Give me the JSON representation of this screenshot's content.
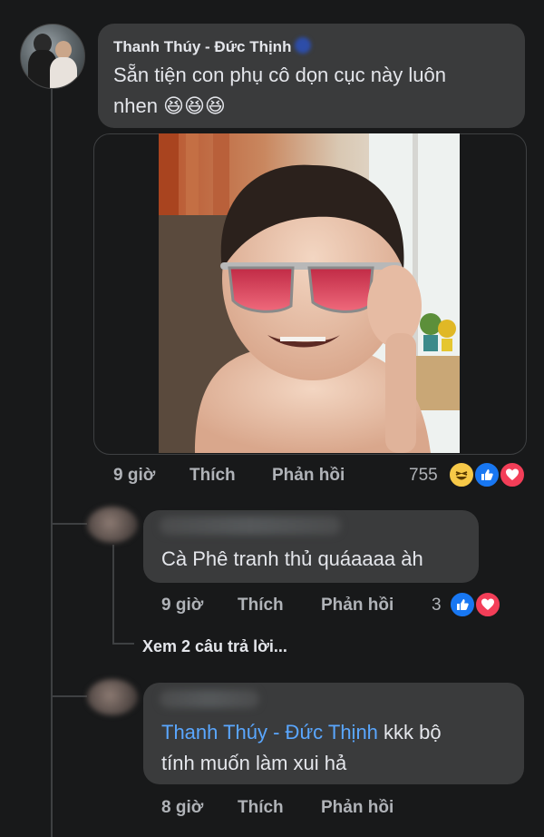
{
  "comment_main": {
    "author": "Thanh Thúy - Đức Thịnh",
    "text_line1": "Sẵn tiện con phụ cô dọn cục này luôn",
    "text_line2": "nhen 😆😆😆",
    "time": "9 giờ",
    "like_label": "Thích",
    "reply_label": "Phản hồi",
    "reaction_count": "755",
    "reactions": [
      "haha-icon",
      "like-icon",
      "love-icon"
    ]
  },
  "reply_1": {
    "text": "Cà Phê tranh thủ quáaaaa àh",
    "time": "9 giờ",
    "like_label": "Thích",
    "reply_label": "Phản hồi",
    "reaction_count": "3",
    "reactions": [
      "like-icon",
      "love-icon"
    ]
  },
  "view_replies": "Xem 2 câu trả lời...",
  "reply_2": {
    "mention": "Thanh Thúy - Đức Thịnh",
    "text_after_mention": " kkk bộ",
    "text_line2": "tính muốn làm xui hả",
    "time": "8 giờ",
    "like_label": "Thích",
    "reply_label": "Phản hồi"
  },
  "colors": {
    "background": "#18191a",
    "bubble": "#3a3b3c",
    "text": "#e4e6eb",
    "secondary_text": "#b0b3b8",
    "mention": "#5aa7ff",
    "like_blue": "#1877f2",
    "love_red": "#f33e58",
    "haha_yellow": "#f7c948"
  }
}
